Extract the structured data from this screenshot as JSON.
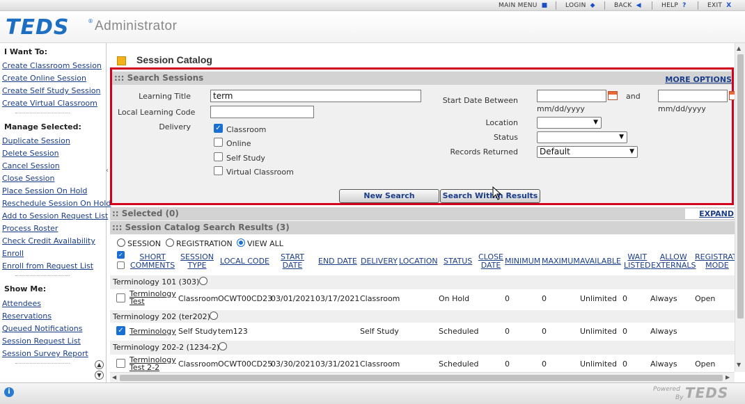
{
  "topnav": {
    "main_menu": "MAIN MENU",
    "login": "LOGIN",
    "back": "BACK",
    "help": "HELP",
    "exit": "EXIT"
  },
  "header": {
    "logo": "TEDS",
    "app_title": "Administrator"
  },
  "sidebar": {
    "i_want_to": "I Want To:",
    "want_items": [
      "Create Classroom Session",
      "Create Online Session",
      "Create Self Study Session",
      "Create Virtual Classroom"
    ],
    "manage_heading": "Manage Selected:",
    "manage_items": [
      "Duplicate Session",
      "Delete Session",
      "Cancel Session",
      "Close Session",
      "Place Session On Hold",
      "Reschedule Session On Hold",
      "Add to Session Request List",
      "Process Roster",
      "Check Credit Availability",
      "Enroll",
      "Enroll from Request List"
    ],
    "show_heading": "Show Me:",
    "show_items": [
      "Attendees",
      "Reservations",
      "Queued Notifications",
      "Session Request List",
      "Session Survey Report"
    ]
  },
  "page": {
    "title": "Session Catalog"
  },
  "search": {
    "bar_title": "::: Search Sessions",
    "more_options": "MORE OPTIONS",
    "learning_title_label": "Learning Title",
    "learning_title_value": "term",
    "local_code_label": "Local Learning Code",
    "local_code_value": "",
    "delivery_label": "Delivery",
    "delivery_options": [
      {
        "label": "Classroom",
        "checked": true
      },
      {
        "label": "Online",
        "checked": false
      },
      {
        "label": "Self Study",
        "checked": false
      },
      {
        "label": "Virtual Classroom",
        "checked": false
      }
    ],
    "start_date_label": "Start Date Between",
    "and_label": "and",
    "date_hint": "mm/dd/yyyy",
    "location_label": "Location",
    "location_value": "",
    "status_label": "Status",
    "status_value": "",
    "records_label": "Records Returned",
    "records_value": "Default",
    "new_search": "New Search",
    "search_within": "Search Within Results"
  },
  "selected": {
    "bar_title": ":: Selected (0)",
    "expand": "EXPAND"
  },
  "results": {
    "bar_title": "::: Session Catalog Search Results (3)",
    "view_options": [
      {
        "label": "SESSION",
        "selected": false
      },
      {
        "label": "REGISTRATION",
        "selected": false
      },
      {
        "label": "VIEW ALL",
        "selected": true
      }
    ],
    "columns": {
      "short_comments": [
        "SHORT",
        "COMMENTS"
      ],
      "session_type": [
        "SESSION",
        "TYPE"
      ],
      "local_code": "LOCAL CODE",
      "start_date": [
        "START",
        "DATE"
      ],
      "end_date": "END DATE",
      "delivery": "DELIVERY",
      "location": "LOCATION",
      "status": "STATUS",
      "close_date": [
        "CLOSE",
        "DATE"
      ],
      "minimum": "MINIMUM",
      "maximum": "MAXIMUM",
      "available": "AVAILABLE",
      "wait_listed": [
        "WAIT",
        "LISTED"
      ],
      "allow_externals": [
        "ALLOW",
        "EXTERNALS"
      ],
      "registration_mode": [
        "REGISTRATI",
        "MODE"
      ]
    },
    "groups": [
      {
        "title": "Terminology 101 (303)",
        "row": {
          "checked": false,
          "name": [
            "Terminology",
            "Test"
          ],
          "type": "Classroom",
          "code": "OCWT00CD23",
          "start": "03/01/2021",
          "end": "03/17/2021",
          "delivery": "Classroom",
          "location": "",
          "status": "On Hold",
          "close": "",
          "min": "0",
          "max": "0",
          "available": "Unlimited",
          "wait": "0",
          "externals": "Always",
          "mode": "Open"
        }
      },
      {
        "title": "Terminology 202 (ter202)",
        "row": {
          "checked": true,
          "name": [
            "Terminology",
            ""
          ],
          "type": "Self Study",
          "code": "tem123",
          "start": "",
          "end": "",
          "delivery": "Self Study",
          "location": "",
          "status": "Scheduled",
          "close": "",
          "min": "0",
          "max": "0",
          "available": "Unlimited",
          "wait": "0",
          "externals": "Always",
          "mode": ""
        }
      },
      {
        "title": "Terminology 202-2 (1234-2)",
        "row": {
          "checked": false,
          "name": [
            "Terminology",
            "Test 2-2"
          ],
          "type": "Classroom",
          "code": "OCWT00CD25",
          "start": "03/30/2021",
          "end": "03/31/2021",
          "delivery": "Classroom",
          "location": "",
          "status": "Scheduled",
          "close": "",
          "min": "0",
          "max": "0",
          "available": "Unlimited",
          "wait": "0",
          "externals": "Always",
          "mode": "Open"
        }
      }
    ]
  },
  "footer": {
    "powered": "Powered",
    "by": "By",
    "logo": "TEDS"
  },
  "colors": {
    "accent_red": "#d3001b",
    "link_blue": "#1a3d8a",
    "logo_blue": "#1d6fc2"
  }
}
